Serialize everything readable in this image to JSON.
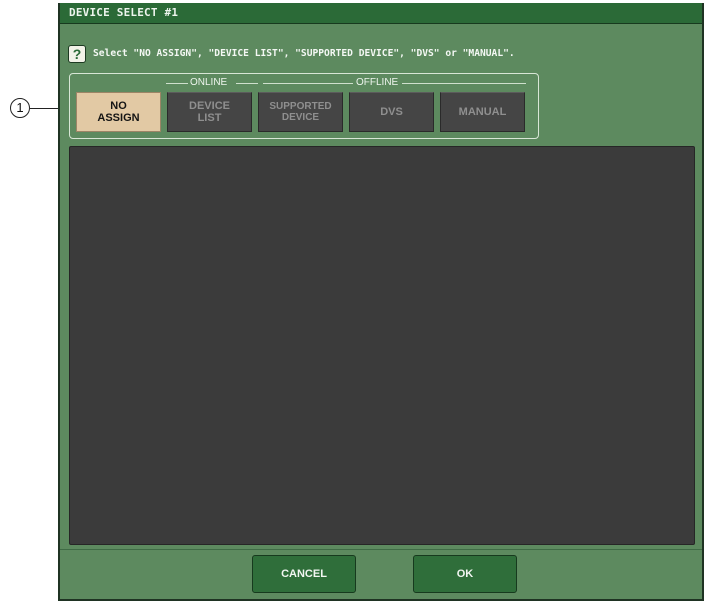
{
  "callout": {
    "number": "1"
  },
  "window": {
    "title": "DEVICE SELECT #1"
  },
  "help": {
    "icon": "question-mark-icon",
    "icon_glyph": "?",
    "instruction": "Select \"NO ASSIGN\", \"DEVICE LIST\", \"SUPPORTED DEVICE\", \"DVS\" or \"MANUAL\"."
  },
  "mode_group": {
    "online_label": "ONLINE",
    "offline_label": "OFFLINE",
    "buttons": [
      {
        "line1": "NO",
        "line2": "ASSIGN",
        "selected": true
      },
      {
        "line1": "DEVICE",
        "line2": "LIST",
        "selected": false
      },
      {
        "line1": "SUPPORTED",
        "line2": "DEVICE",
        "selected": false
      },
      {
        "line1": "DVS",
        "line2": "",
        "selected": false
      },
      {
        "line1": "MANUAL",
        "line2": "",
        "selected": false
      }
    ]
  },
  "footer": {
    "cancel_label": "CANCEL",
    "ok_label": "OK"
  },
  "colors": {
    "window_bg": "#5d8a5f",
    "titlebar_bg": "#2b6a37",
    "button_selected": "#e2c9a4",
    "button_inactive": "#454545",
    "list_bg": "#3b3b3b"
  }
}
